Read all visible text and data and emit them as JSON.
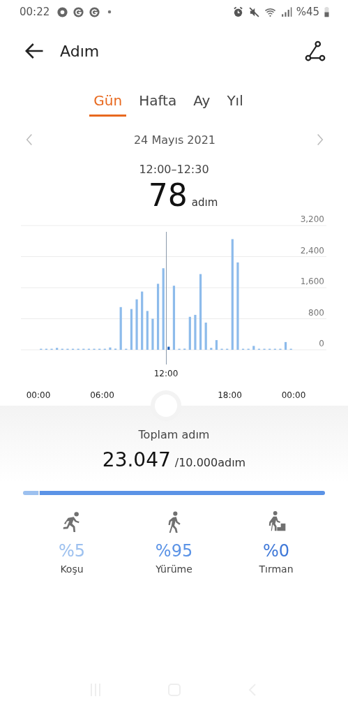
{
  "status_bar": {
    "time": "00:22",
    "battery": "%45"
  },
  "header": {
    "title": "Adım"
  },
  "tabs": [
    {
      "label": "Gün",
      "selected": true
    },
    {
      "label": "Hafta",
      "selected": false
    },
    {
      "label": "Ay",
      "selected": false
    },
    {
      "label": "Yıl",
      "selected": false
    }
  ],
  "date": "24 Mayıs 2021",
  "reading": {
    "range": "12:00–12:30",
    "value": "78",
    "unit": "adım"
  },
  "chart_data": {
    "type": "bar",
    "x": [
      0,
      0.5,
      1,
      1.5,
      2,
      2.5,
      3,
      3.5,
      4,
      4.5,
      5,
      5.5,
      6,
      6.5,
      7,
      7.5,
      8,
      8.5,
      9,
      9.5,
      10,
      10.5,
      11,
      11.5,
      12,
      12.5,
      13,
      13.5,
      14,
      14.5,
      15,
      15.5,
      16,
      16.5,
      17,
      17.5,
      18,
      18.5,
      19,
      19.5,
      20,
      20.5,
      21,
      21.5,
      22,
      22.5,
      23,
      23.5
    ],
    "series": [
      {
        "color": "#8dbbeb",
        "values": [
          0,
          0,
          0,
          50,
          0,
          0,
          0,
          0,
          0,
          0,
          0,
          0,
          20,
          60,
          30,
          1100,
          0,
          1050,
          1300,
          1500,
          1000,
          800,
          1700,
          2100,
          null,
          1650,
          20,
          30,
          850,
          900,
          1950,
          700,
          50,
          250,
          20,
          20,
          2850,
          2250,
          20,
          20,
          100,
          0,
          0,
          0,
          0,
          0,
          200,
          0
        ]
      },
      {
        "color": "#1f5fb8",
        "values": [
          null,
          null,
          null,
          null,
          null,
          null,
          null,
          null,
          null,
          null,
          null,
          null,
          null,
          null,
          null,
          null,
          null,
          null,
          null,
          null,
          null,
          null,
          null,
          null,
          80,
          null,
          null,
          null,
          null,
          null,
          null,
          null,
          null,
          null,
          null,
          null,
          null,
          null,
          null,
          null,
          null,
          null,
          null,
          null,
          null,
          null,
          null,
          null
        ]
      }
    ],
    "grid": true,
    "xlim": [
      0,
      24
    ],
    "ylim": [
      0,
      3200
    ],
    "xticks": [
      {
        "value": 0,
        "label": "00:00"
      },
      {
        "value": 6,
        "label": "06:00"
      },
      {
        "value": 18,
        "label": "18:00"
      },
      {
        "value": 24,
        "label": "00:00"
      }
    ],
    "yticks": [
      {
        "value": 0,
        "label": "0"
      },
      {
        "value": 800,
        "label": "800"
      },
      {
        "value": 1600,
        "label": "1,600"
      },
      {
        "value": 2400,
        "label": "2,400"
      },
      {
        "value": 3200,
        "label": "3,200"
      }
    ],
    "annotations": [
      "12:00"
    ]
  },
  "total": {
    "label": "Toplam adım",
    "value": "23.047",
    "goal": "/10.000adım"
  },
  "activities": [
    {
      "kind": "run",
      "percent": "%5",
      "label": "Koşu",
      "level": 0.05,
      "color": "#9cc0ef"
    },
    {
      "kind": "walk",
      "percent": "%95",
      "label": "Yürüme",
      "level": 0.95,
      "color": "#5b93e6"
    },
    {
      "kind": "climb",
      "percent": "%0",
      "label": "Tırman",
      "color": "#3f78d8"
    }
  ]
}
